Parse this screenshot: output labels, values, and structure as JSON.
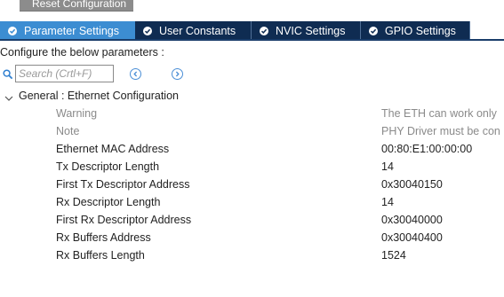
{
  "toolbar": {
    "reset_label": "Reset Configuration"
  },
  "tabs": [
    {
      "label": "Parameter Settings",
      "active": true,
      "icon": "check-circle-icon"
    },
    {
      "label": "User Constants",
      "active": false,
      "icon": "check-circle-icon"
    },
    {
      "label": "NVIC Settings",
      "active": false,
      "icon": "check-circle-icon"
    },
    {
      "label": "GPIO Settings",
      "active": false,
      "icon": "check-circle-icon"
    }
  ],
  "configure_label": "Configure the below parameters :",
  "search": {
    "placeholder": "Search (Crtl+F)",
    "value": ""
  },
  "group": {
    "label": "General : Ethernet Configuration",
    "expanded": true
  },
  "parameters": [
    {
      "name": "Warning",
      "value": "The ETH can work only",
      "muted": true
    },
    {
      "name": "Note",
      "value": "PHY Driver must be con",
      "muted": true
    },
    {
      "name": "Ethernet MAC Address",
      "value": "00:80:E1:00:00:00",
      "muted": false
    },
    {
      "name": "Tx Descriptor Length",
      "value": "14",
      "muted": false
    },
    {
      "name": "First Tx Descriptor Address",
      "value": "0x30040150",
      "muted": false
    },
    {
      "name": "Rx Descriptor Length",
      "value": "14",
      "muted": false
    },
    {
      "name": "First Rx Descriptor Address",
      "value": "0x30040000",
      "muted": false
    },
    {
      "name": "Rx Buffers Address",
      "value": "0x30040400",
      "muted": false
    },
    {
      "name": "Rx Buffers Length",
      "value": "1524",
      "muted": false
    }
  ],
  "colors": {
    "tab_active": "#3c8dd2",
    "tab_inactive": "#0f2c52",
    "muted_text": "#8a8a8a",
    "accent": "#4a8ed6"
  }
}
